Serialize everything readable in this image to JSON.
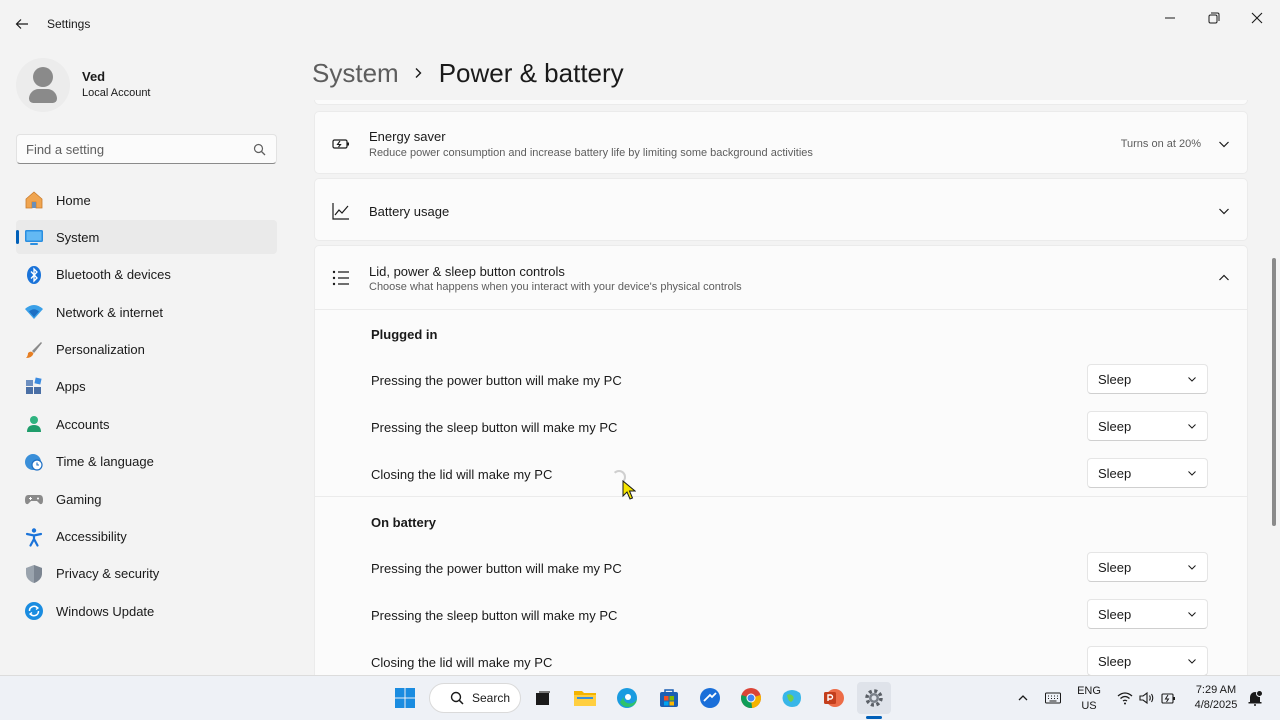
{
  "window": {
    "app_title": "Settings"
  },
  "profile": {
    "name": "Ved",
    "account_type": "Local Account"
  },
  "search": {
    "placeholder": "Find a setting"
  },
  "sidebar": {
    "items": [
      {
        "label": "Home",
        "icon": "home-icon"
      },
      {
        "label": "System",
        "icon": "system-icon",
        "active": true
      },
      {
        "label": "Bluetooth & devices",
        "icon": "bluetooth-icon"
      },
      {
        "label": "Network & internet",
        "icon": "network-icon"
      },
      {
        "label": "Personalization",
        "icon": "brush-icon"
      },
      {
        "label": "Apps",
        "icon": "apps-icon"
      },
      {
        "label": "Accounts",
        "icon": "accounts-icon"
      },
      {
        "label": "Time & language",
        "icon": "globe-clock-icon"
      },
      {
        "label": "Gaming",
        "icon": "gamepad-icon"
      },
      {
        "label": "Accessibility",
        "icon": "accessibility-icon"
      },
      {
        "label": "Privacy & security",
        "icon": "shield-icon"
      },
      {
        "label": "Windows Update",
        "icon": "update-icon"
      }
    ]
  },
  "breadcrumb": {
    "parent": "System",
    "current": "Power & battery"
  },
  "cards": {
    "energy_saver": {
      "title": "Energy saver",
      "subtitle": "Reduce power consumption and increase battery life by limiting some background activities",
      "status": "Turns on at 20%"
    },
    "battery_usage": {
      "title": "Battery usage"
    },
    "lid_controls": {
      "title": "Lid, power & sleep button controls",
      "subtitle": "Choose what happens when you interact with your device's physical controls"
    }
  },
  "lid_settings": {
    "plugged_in": {
      "heading": "Plugged in",
      "rows": [
        {
          "label": "Pressing the power button will make my PC",
          "value": "Sleep"
        },
        {
          "label": "Pressing the sleep button will make my PC",
          "value": "Sleep"
        },
        {
          "label": "Closing the lid will make my PC",
          "value": "Sleep"
        }
      ]
    },
    "on_battery": {
      "heading": "On battery",
      "rows": [
        {
          "label": "Pressing the power button will make my PC",
          "value": "Sleep"
        },
        {
          "label": "Pressing the sleep button will make my PC",
          "value": "Sleep"
        },
        {
          "label": "Closing the lid will make my PC",
          "value": "Sleep"
        }
      ]
    }
  },
  "taskbar": {
    "search_label": "Search",
    "language_line1": "ENG",
    "language_line2": "US",
    "time": "7:29 AM",
    "date": "4/8/2025"
  },
  "colors": {
    "accent": "#005fb8",
    "window_bg": "#f3f3f3",
    "card_bg": "#fbfbfb"
  }
}
